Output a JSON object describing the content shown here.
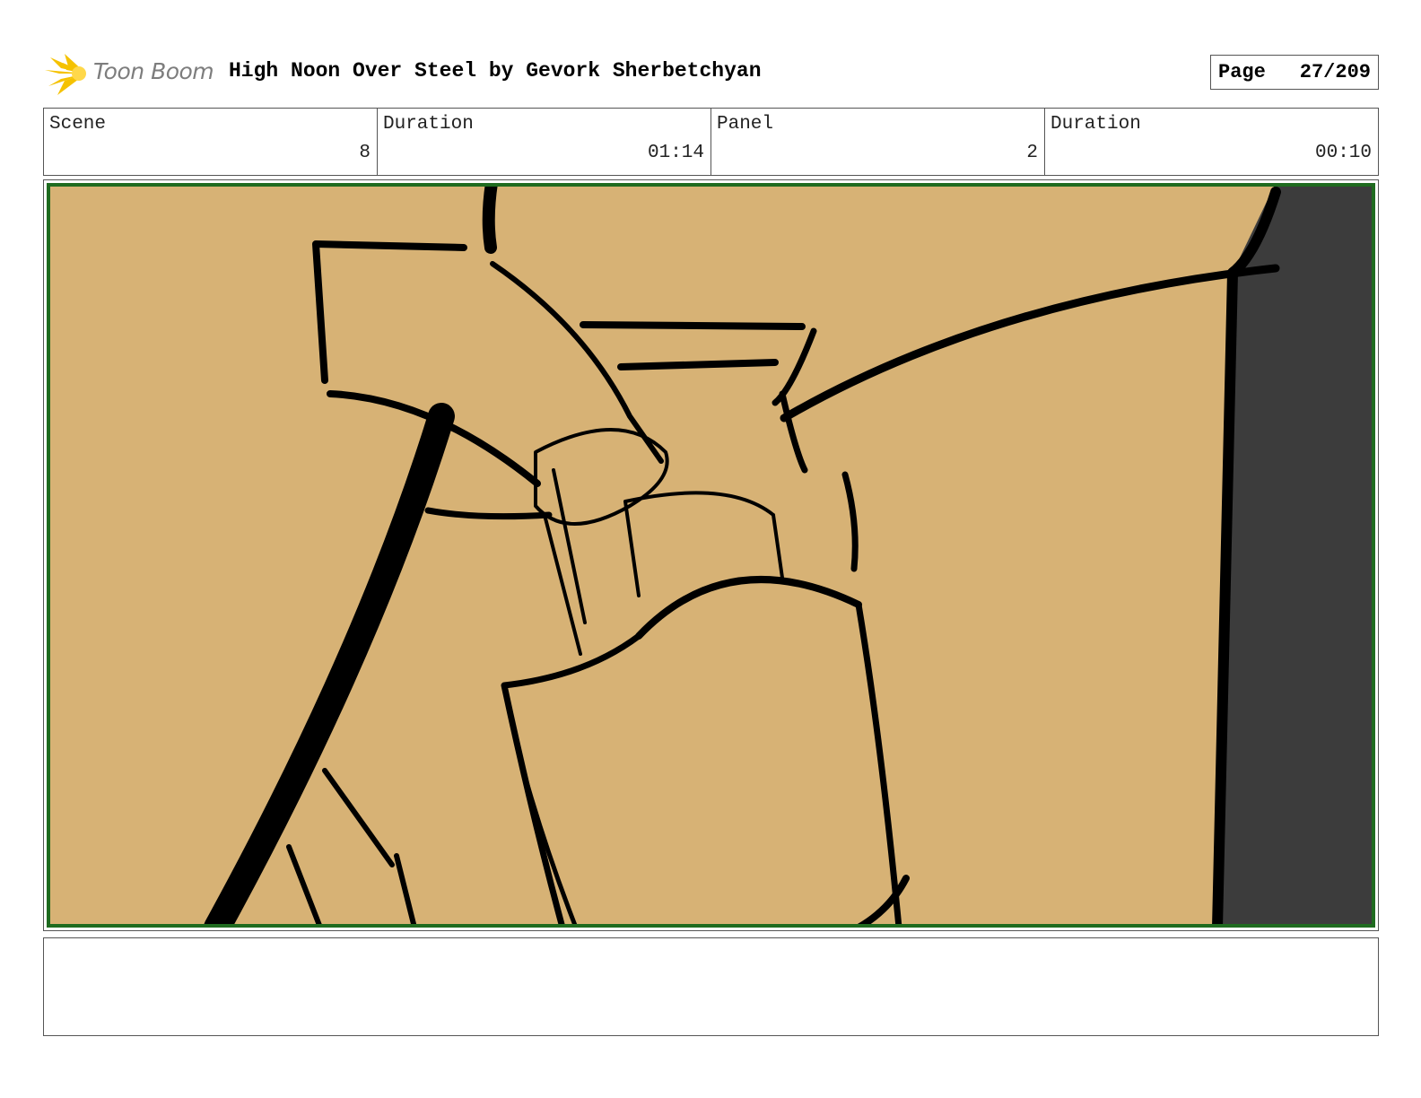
{
  "header": {
    "logo_text": "Toon Boom",
    "title": "High Noon Over Steel by Gevork Sherbetchyan",
    "page_label": "Page",
    "page_number": "27/209"
  },
  "info": {
    "scene_label": "Scene",
    "scene_value": "8",
    "scene_duration_label": "Duration",
    "scene_duration_value": "01:14",
    "panel_label": "Panel",
    "panel_value": "2",
    "panel_duration_label": "Duration",
    "panel_duration_value": "00:10"
  },
  "panel": {
    "background_color": "#d7b275",
    "shadow_color": "#3c3c3c",
    "border_color": "#1f6b1f"
  },
  "notes": {
    "text": ""
  }
}
